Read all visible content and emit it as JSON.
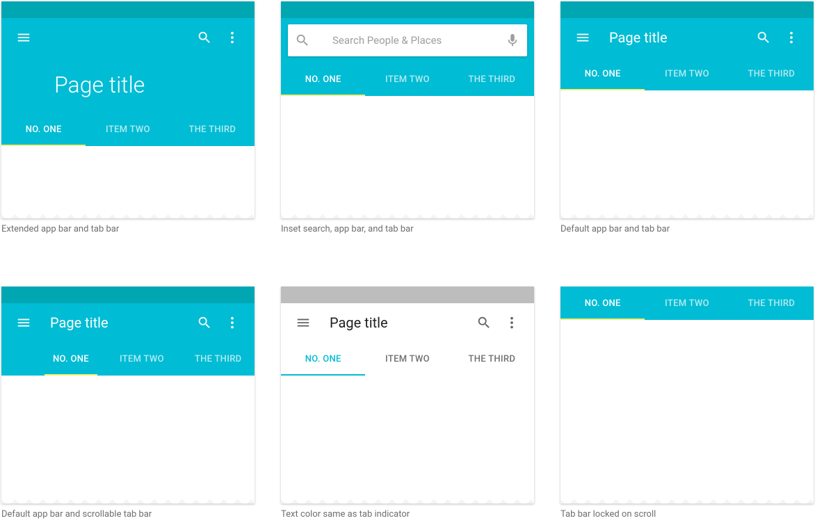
{
  "colors": {
    "primary": "#00bcd4",
    "primary_dark": "#00a7b3",
    "accent": "#fff176"
  },
  "shared": {
    "page_title": "Page title",
    "tabs": [
      "NO. ONE",
      "ITEM TWO",
      "THE THIRD"
    ]
  },
  "search": {
    "placeholder": "Search People  & Places"
  },
  "captions": {
    "c1": "Extended app bar and tab bar",
    "c2": "Inset search, app bar, and tab bar",
    "c3": "Default app bar and tab bar",
    "c4": "Default app bar and scrollable tab bar",
    "c5": "Text color same as tab indicator",
    "c6": "Tab bar locked on scroll"
  }
}
